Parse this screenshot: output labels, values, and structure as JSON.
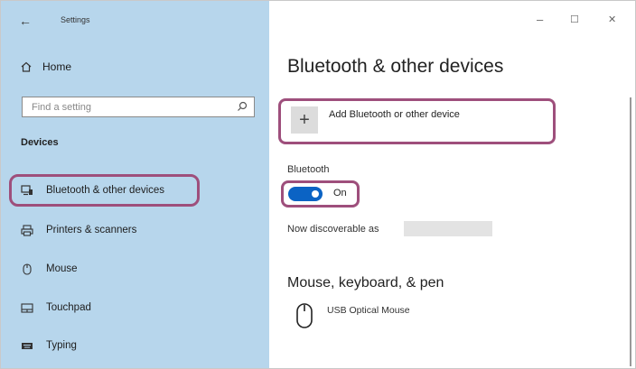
{
  "window": {
    "title": "Settings",
    "controls": {
      "minimize": "–",
      "maximize": "☐",
      "close": "✕"
    }
  },
  "sidebar": {
    "back_icon": "back-arrow-icon",
    "home_label": "Home",
    "search_placeholder": "Find a setting",
    "section_label": "Devices",
    "items": [
      {
        "label": "Bluetooth & other devices",
        "icon": "bluetooth-devices-icon",
        "selected": true
      },
      {
        "label": "Printers & scanners",
        "icon": "printer-icon"
      },
      {
        "label": "Mouse",
        "icon": "mouse-icon"
      },
      {
        "label": "Touchpad",
        "icon": "touchpad-icon"
      },
      {
        "label": "Typing",
        "icon": "keyboard-icon"
      }
    ]
  },
  "main": {
    "title": "Bluetooth & other devices",
    "add_button_label": "Add Bluetooth or other device",
    "bluetooth_label": "Bluetooth",
    "toggle_state": "On",
    "discoverable_text": "Now discoverable as",
    "section_heading": "Mouse, keyboard, & pen",
    "devices": [
      {
        "name": "USB Optical Mouse",
        "icon": "mouse-icon"
      }
    ]
  },
  "colors": {
    "sidebar_bg": "#b7d6ec",
    "highlight_border": "#9e4f7c",
    "toggle_on": "#0b63c4"
  }
}
